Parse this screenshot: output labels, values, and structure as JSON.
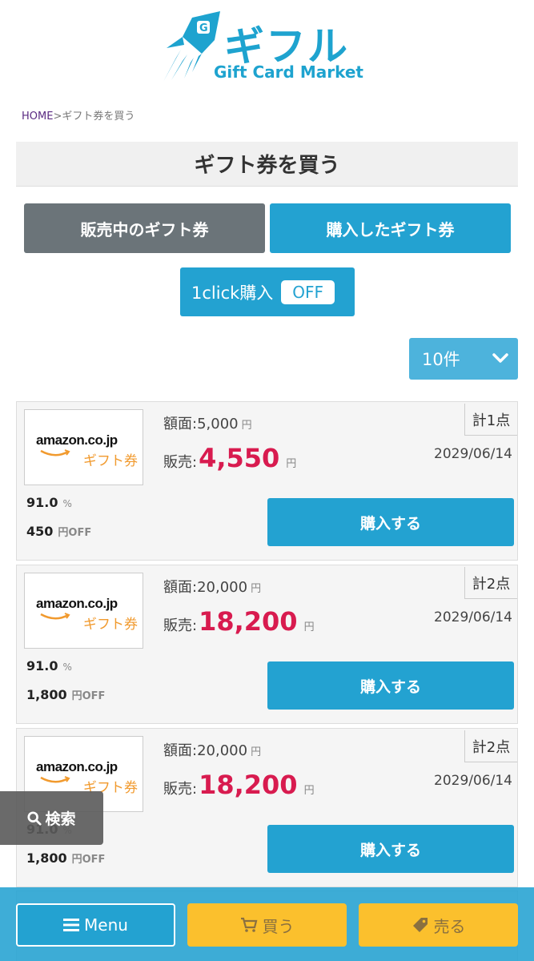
{
  "brand": {
    "name_jp": "ギフル",
    "name_en": "Gift Card Market",
    "color": "#1ea3cf"
  },
  "breadcrumb": {
    "home": "HOME",
    "separator": ">",
    "current": "ギフト券を買う"
  },
  "page_title": "ギフト券を買う",
  "tabs": {
    "selling": "販売中のギフト券",
    "purchased": "購入したギフト券"
  },
  "oneclick": {
    "label": "1click購入",
    "state": "OFF"
  },
  "per_page": {
    "selected": "10件",
    "icon": "chevron-down-icon"
  },
  "listing_labels": {
    "face_label": "額面:",
    "sale_label": "販売:",
    "yen": "円",
    "percent": "%",
    "yen_off": "円OFF",
    "buy_label": "購入する",
    "brand_text": "amazon.co.jp",
    "brand_sub": "ギフト券"
  },
  "listings": [
    {
      "face": "5,000",
      "price": "4,550",
      "qty": "計1点",
      "date": "2029/06/14",
      "rate": "91.0",
      "off": "450"
    },
    {
      "face": "20,000",
      "price": "18,200",
      "qty": "計2点",
      "date": "2029/06/14",
      "rate": "91.0",
      "off": "1,800"
    },
    {
      "face": "20,000",
      "price": "18,200",
      "qty": "計2点",
      "date": "2029/06/14",
      "rate": "91.0",
      "off": "1,800"
    }
  ],
  "search_float": {
    "label": "検索",
    "icon": "search-icon"
  },
  "bottom_nav": {
    "menu": "Menu",
    "buy": "買う",
    "sell": "売る"
  },
  "colors": {
    "primary": "#23a2d1",
    "gray_tab": "#6b7479",
    "price": "#d81b4f",
    "accent_yellow": "#fbc02d"
  }
}
